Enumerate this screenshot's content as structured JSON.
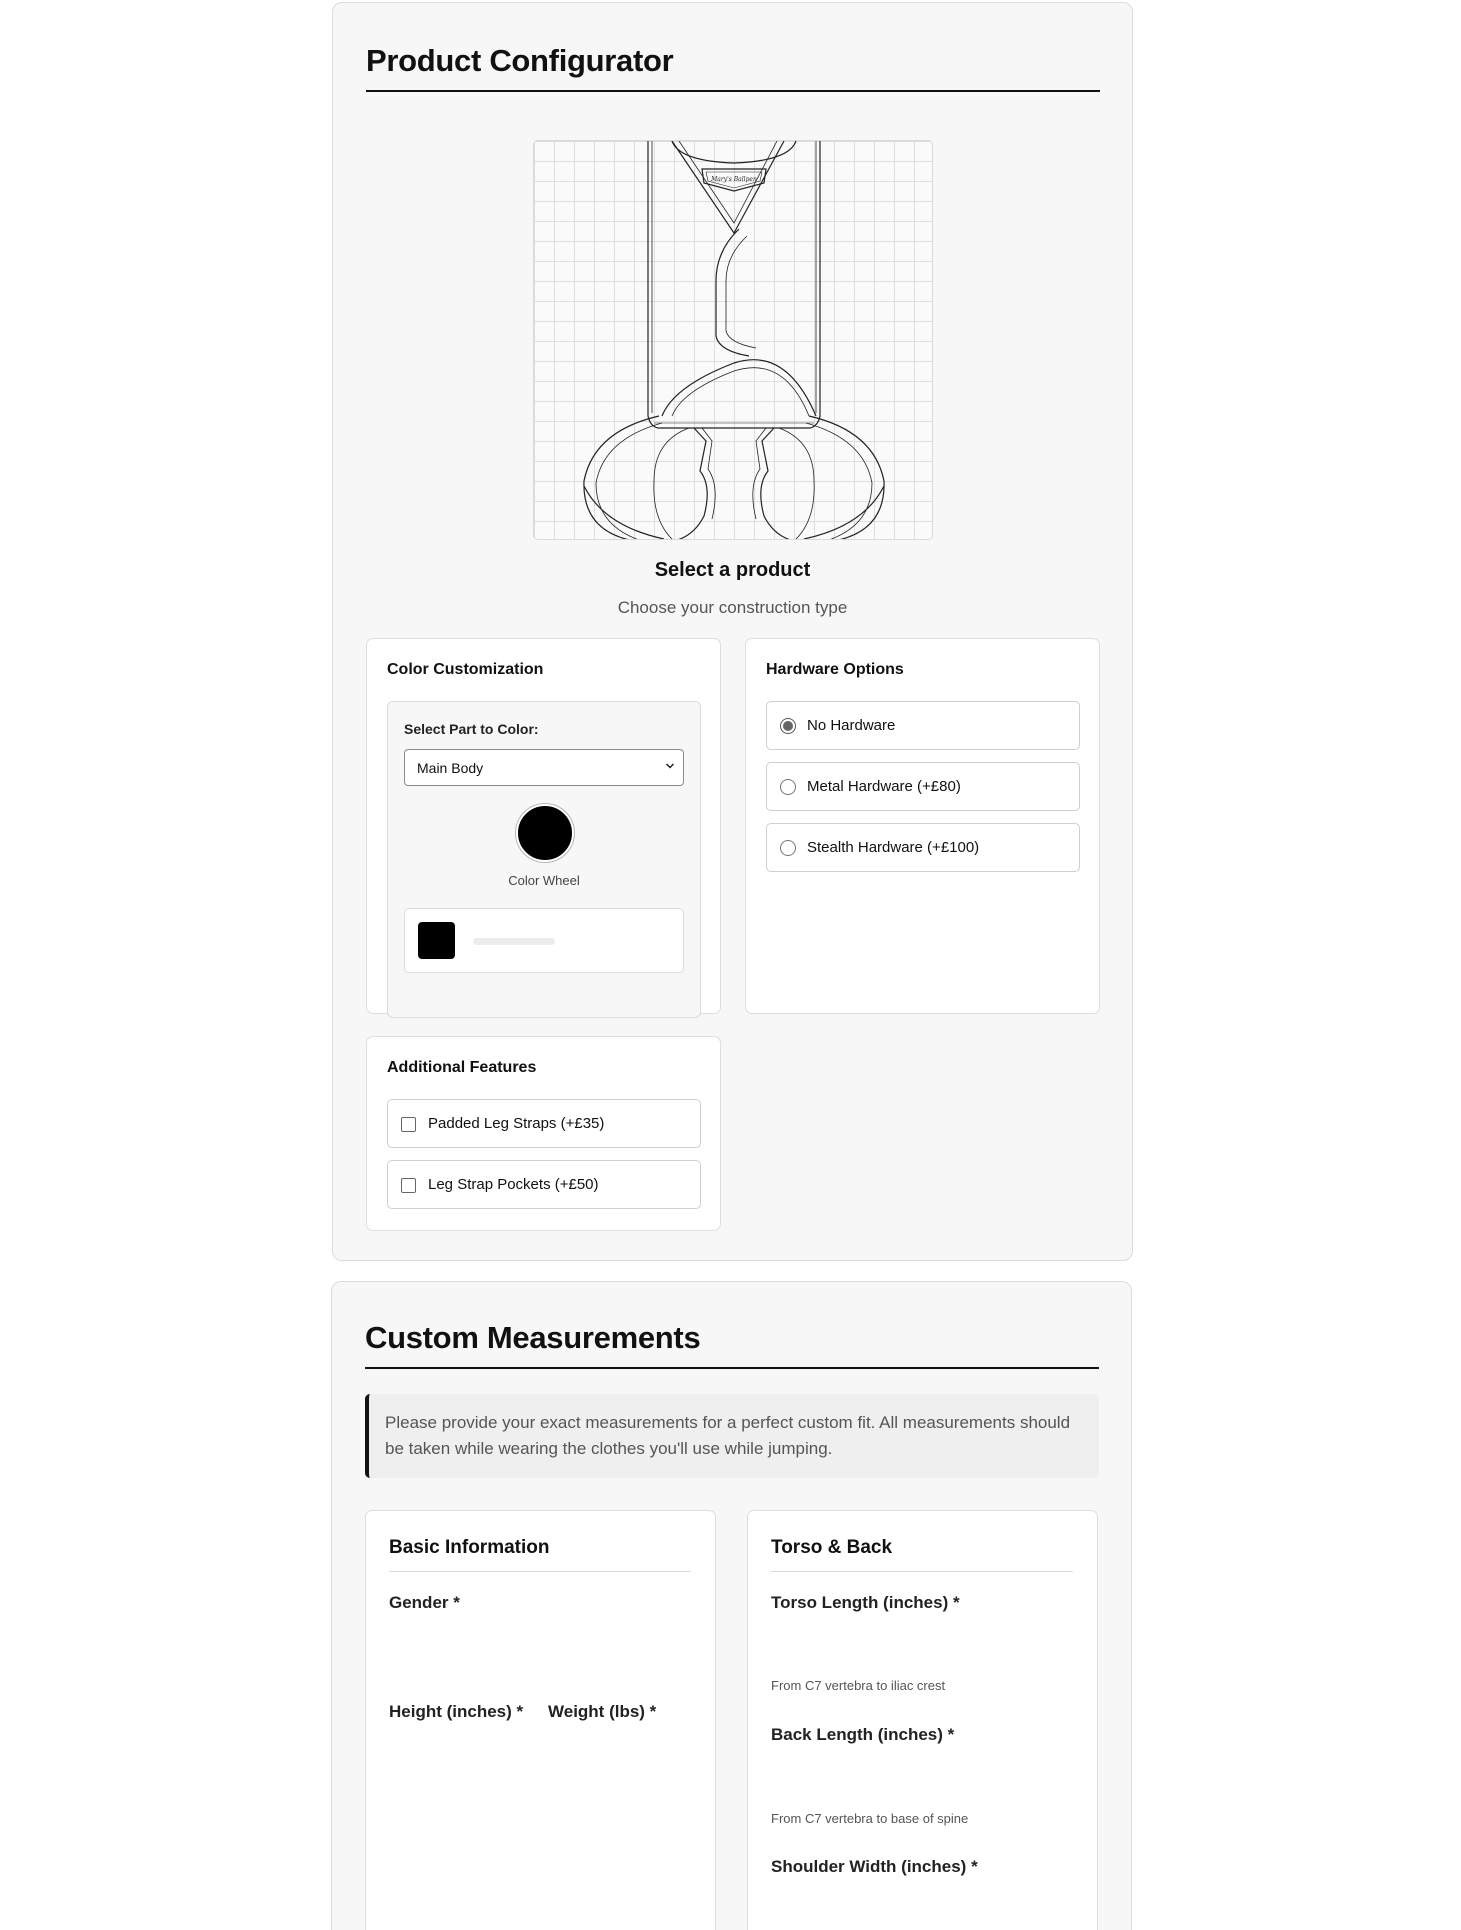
{
  "configurator": {
    "title": "Product Configurator",
    "product_title": "Select a product",
    "product_subtitle": "Choose your construction type",
    "color_card": {
      "title": "Color Customization",
      "select_label": "Select Part to Color:",
      "selected_part": "Main Body",
      "wheel_label": "Color Wheel",
      "selected_color": "#000000"
    },
    "hardware_card": {
      "title": "Hardware Options",
      "options": [
        {
          "label": "No Hardware",
          "selected": true
        },
        {
          "label": "Metal Hardware (+£80)",
          "selected": false
        },
        {
          "label": "Stealth Hardware (+£100)",
          "selected": false
        }
      ]
    },
    "features_card": {
      "title": "Additional Features",
      "options": [
        {
          "label": "Padded Leg Straps (+£35)",
          "checked": false
        },
        {
          "label": "Leg Strap Pockets (+£50)",
          "checked": false
        }
      ]
    }
  },
  "measurements": {
    "title": "Custom Measurements",
    "note": "Please provide your exact measurements for a perfect custom fit. All measurements should be taken while wearing the clothes you'll use while jumping.",
    "basic": {
      "title": "Basic Information",
      "gender_label": "Gender *",
      "height_label": "Height (inches) *",
      "weight_label": "Weight (lbs) *"
    },
    "torso": {
      "title": "Torso & Back",
      "torso_label": "Torso Length (inches) *",
      "torso_hint": "From C7 vertebra to iliac crest",
      "back_label": "Back Length (inches) *",
      "back_hint": "From C7 vertebra to base of spine",
      "shoulder_label": "Shoulder Width (inches) *"
    }
  }
}
